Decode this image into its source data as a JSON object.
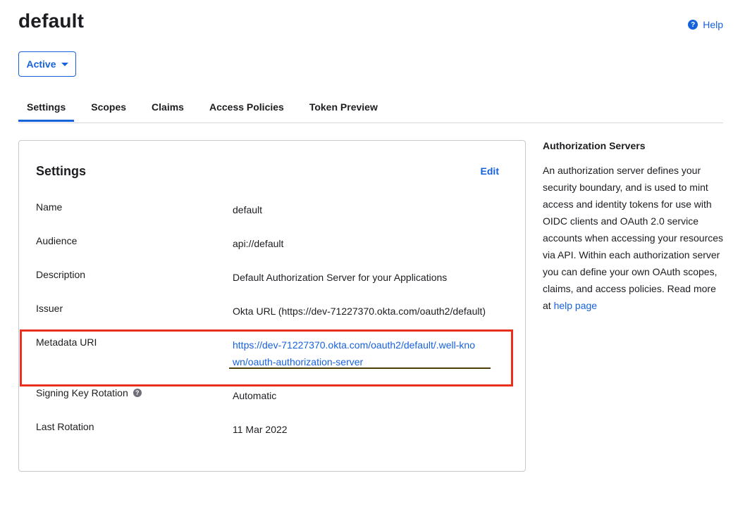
{
  "header": {
    "title": "default",
    "help_label": "Help",
    "help_icon_glyph": "?"
  },
  "status": {
    "selected": "Active"
  },
  "tabs": [
    {
      "label": "Settings",
      "active": true
    },
    {
      "label": "Scopes",
      "active": false
    },
    {
      "label": "Claims",
      "active": false
    },
    {
      "label": "Access Policies",
      "active": false
    },
    {
      "label": "Token Preview",
      "active": false
    }
  ],
  "settings": {
    "title": "Settings",
    "edit_label": "Edit",
    "rows": [
      {
        "label": "Name",
        "value": "default"
      },
      {
        "label": "Audience",
        "value": "api://default"
      },
      {
        "label": "Description",
        "value": "Default Authorization Server for your Applications"
      },
      {
        "label": "Issuer",
        "value": "Okta URL (https://dev-71227370.okta.com/oauth2/default)"
      },
      {
        "label": "Metadata URI",
        "value": "https://dev-71227370.okta.com/oauth2/default/.well-known/oauth-authorization-server"
      },
      {
        "label": "Signing Key Rotation",
        "value": "Automatic"
      },
      {
        "label": "Last Rotation",
        "value": "11 Mar 2022"
      }
    ]
  },
  "sidebar": {
    "title": "Authorization Servers",
    "description": "An authorization server defines your security boundary, and is used to mint access and identity tokens for use with OIDC clients and OAuth 2.0 service accounts when accessing your resources via API. Within each authorization server you can define your own OAuth scopes, claims, and access policies. Read more at ",
    "link_label": "help page"
  },
  "colors": {
    "accent": "#1662dd",
    "highlight_box": "#e8301c",
    "annotation_underline": "#4e3e05"
  }
}
